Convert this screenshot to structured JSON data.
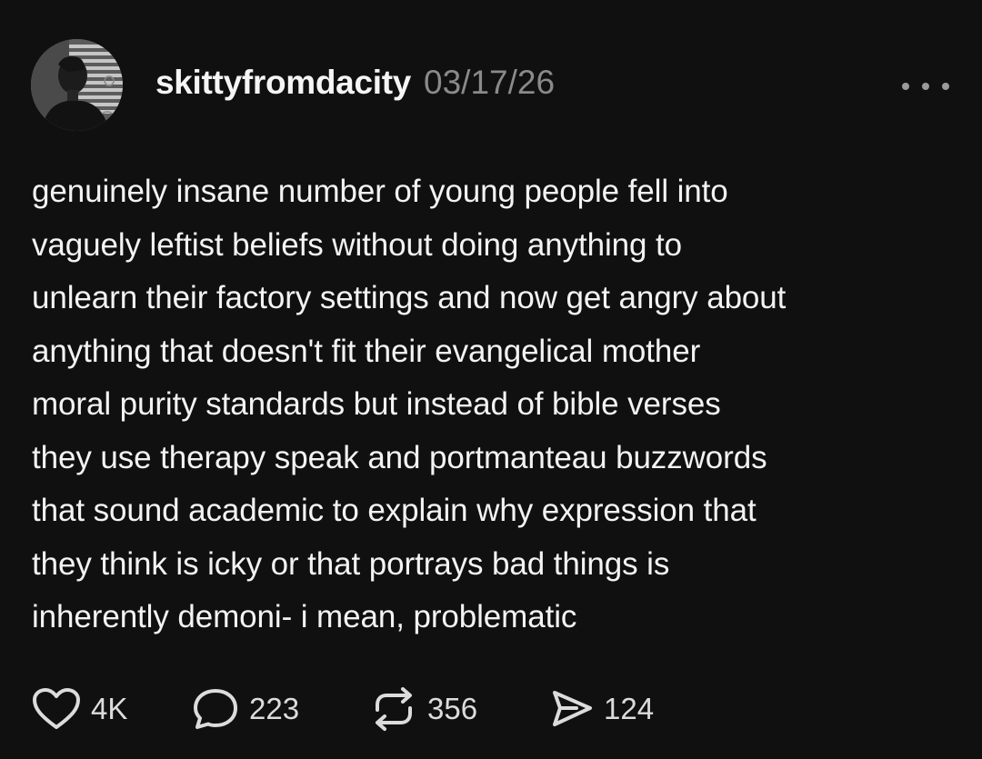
{
  "post": {
    "author": {
      "username": "skittyfromdacity",
      "avatar_icon": "profile-photo"
    },
    "date": "03/17/26",
    "more_icon": "more-horizontal-icon",
    "text": "genuinely insane number of young people fell into\nvaguely leftist beliefs without doing anything to\nunlearn their factory settings and now get angry about\nanything that doesn't fit their evangelical mother\nmoral purity standards but instead of bible verses\nthey use therapy speak and portmanteau buzzwords\nthat sound academic to explain why expression that\nthey think is icky or that portrays bad things is\ninherently demoni- i mean, problematic",
    "actions": {
      "likes": {
        "icon": "heart-icon",
        "count": "4K"
      },
      "comments": {
        "icon": "comment-icon",
        "count": "223"
      },
      "reposts": {
        "icon": "repost-icon",
        "count": "356"
      },
      "shares": {
        "icon": "share-icon",
        "count": "124"
      }
    }
  },
  "colors": {
    "background": "#101010",
    "text": "#f3f3f3",
    "muted": "#8a8a8a",
    "icon": "#dcdcdc"
  }
}
